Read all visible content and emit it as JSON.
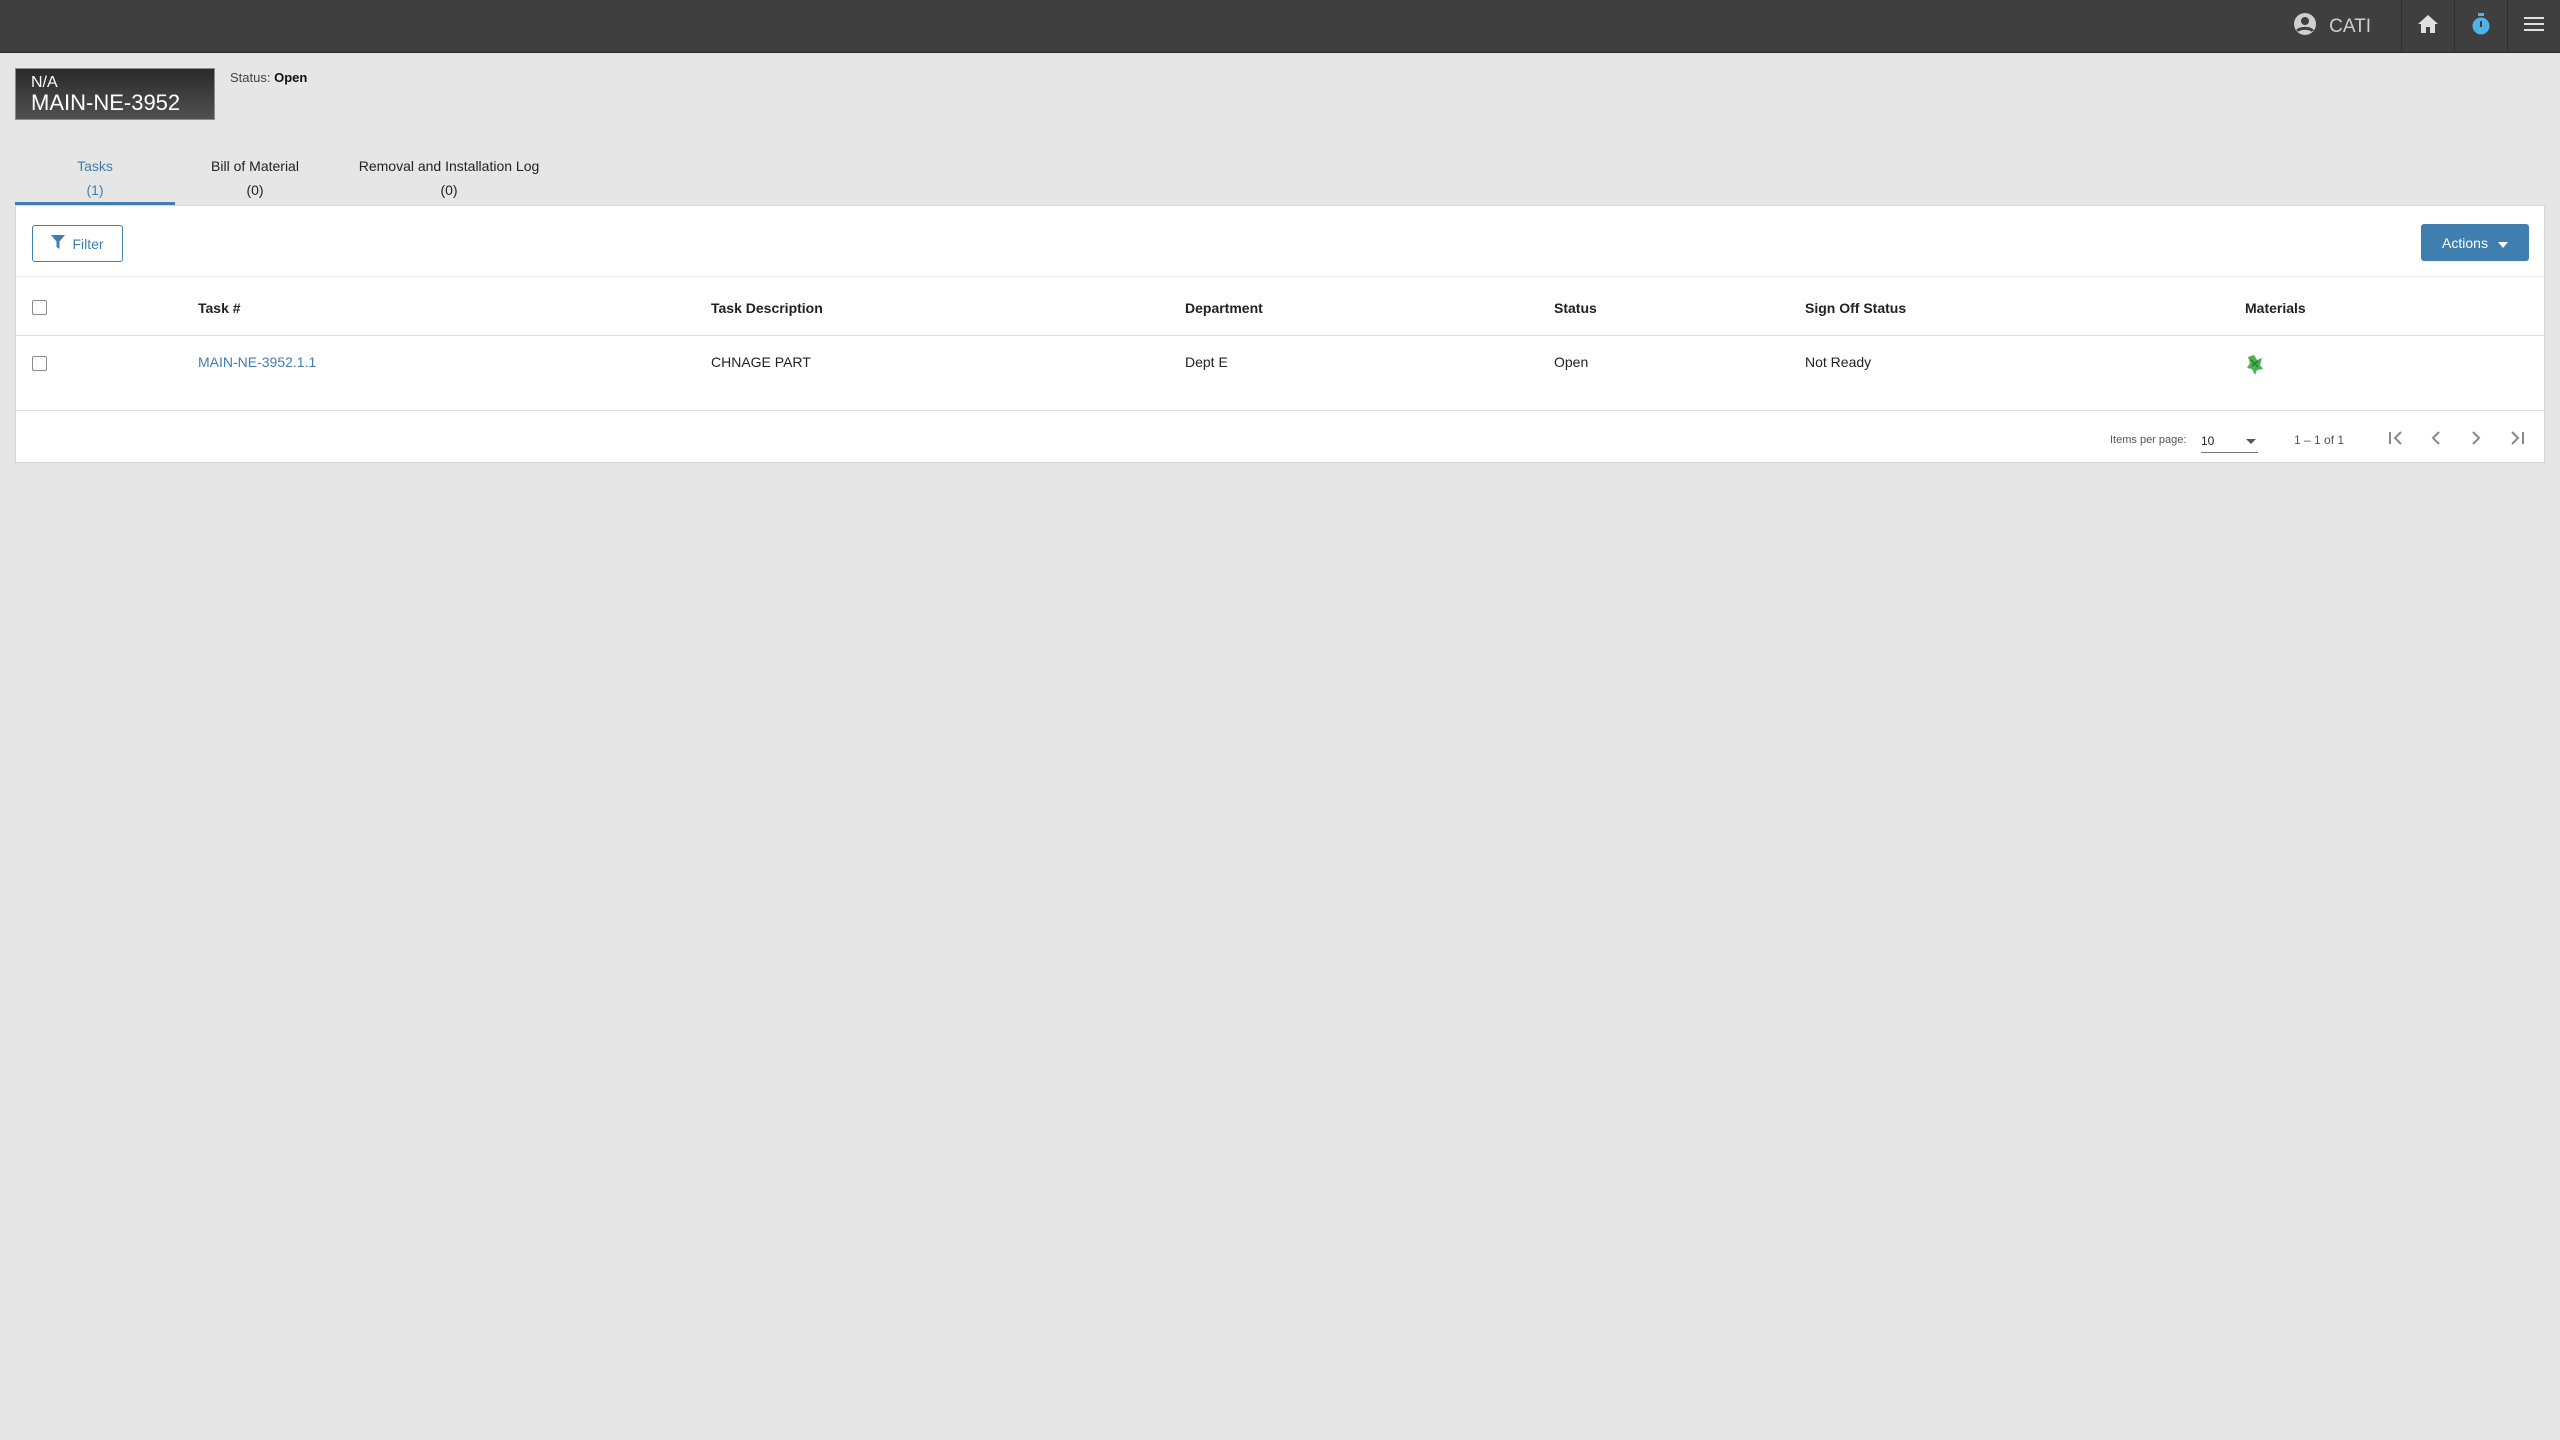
{
  "topbar": {
    "user_name": "CATI",
    "icons": [
      "account-circle-icon",
      "home-icon",
      "timer-icon",
      "menu-icon"
    ],
    "colors": {
      "bar": "#3f3f3f",
      "timer": "#4fb3e8"
    }
  },
  "record": {
    "subtitle": "N/A",
    "id": "MAIN-NE-3952",
    "status_label": "Status:",
    "status_value": "Open"
  },
  "tabs": [
    {
      "label": "Tasks",
      "count": "(1)",
      "active": true
    },
    {
      "label": "Bill of Material",
      "count": "(0)",
      "active": false
    },
    {
      "label": "Removal and Installation Log",
      "count": "(0)",
      "active": false
    }
  ],
  "toolbar": {
    "filter_label": "Filter",
    "actions_label": "Actions"
  },
  "table": {
    "columns": [
      "Task #",
      "Task Description",
      "Department",
      "Status",
      "Sign Off Status",
      "Materials"
    ],
    "rows": [
      {
        "task_no": "MAIN-NE-3952.1.1",
        "description": "CHNAGE PART",
        "department": "Dept E",
        "status": "Open",
        "sign_off_status": "Not Ready",
        "materials_icon": "materials-status-icon"
      }
    ]
  },
  "pager": {
    "items_per_page_label": "Items per page:",
    "items_per_page": "10",
    "range": "1 – 1 of 1"
  },
  "colors": {
    "accent": "#3f7fb0",
    "materials_icon": "#4caf50"
  }
}
